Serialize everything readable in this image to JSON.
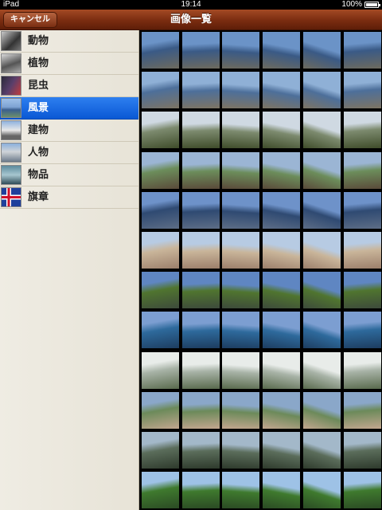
{
  "status": {
    "device": "iPad",
    "time": "19:14",
    "battery": "100%"
  },
  "navbar": {
    "title": "画像一覧",
    "cancel_label": "キャンセル"
  },
  "sidebar": {
    "items": [
      {
        "label": "動物",
        "icon": "animal-thumb-icon",
        "selected": false
      },
      {
        "label": "植物",
        "icon": "plant-thumb-icon",
        "selected": false
      },
      {
        "label": "昆虫",
        "icon": "insect-thumb-icon",
        "selected": false
      },
      {
        "label": "風景",
        "icon": "landscape-thumb-icon",
        "selected": true
      },
      {
        "label": "建物",
        "icon": "building-thumb-icon",
        "selected": false
      },
      {
        "label": "人物",
        "icon": "person-thumb-icon",
        "selected": false
      },
      {
        "label": "物品",
        "icon": "object-thumb-icon",
        "selected": false
      },
      {
        "label": "旗章",
        "icon": "flag-thumb-icon",
        "selected": false
      }
    ]
  },
  "colors": {
    "navbar": "#7a2c10",
    "selected_row": "#1a6ae6",
    "grid_background": "#000000"
  },
  "grid": {
    "columns": 6,
    "rows": 12,
    "palette": [
      [
        "#6b93c7",
        "#3a5a86",
        "#6d6a5e"
      ],
      [
        "#8fb0d6",
        "#4d6f9a",
        "#7d7463"
      ],
      [
        "#cfd9e2",
        "#7c8a6e",
        "#3f4c2a"
      ],
      [
        "#9bb5d4",
        "#6c8d5b",
        "#5a4a3a"
      ],
      [
        "#6e92c9",
        "#2f4a72",
        "#5d6d86"
      ],
      [
        "#b7cbe3",
        "#c9b59a",
        "#9c7f6b"
      ],
      [
        "#5f86c2",
        "#50752f",
        "#3d4a3b"
      ],
      [
        "#7c9ed1",
        "#2e6a9c",
        "#1d3d60"
      ],
      [
        "#e8ece9",
        "#a8b3a7",
        "#596a4d"
      ],
      [
        "#8aa7c9",
        "#6c8a5a",
        "#c2a68f"
      ],
      [
        "#a3b8c9",
        "#5b6d5b",
        "#2e3a2c"
      ],
      [
        "#9ec2e6",
        "#3f7a2e",
        "#2b4a24"
      ]
    ]
  }
}
